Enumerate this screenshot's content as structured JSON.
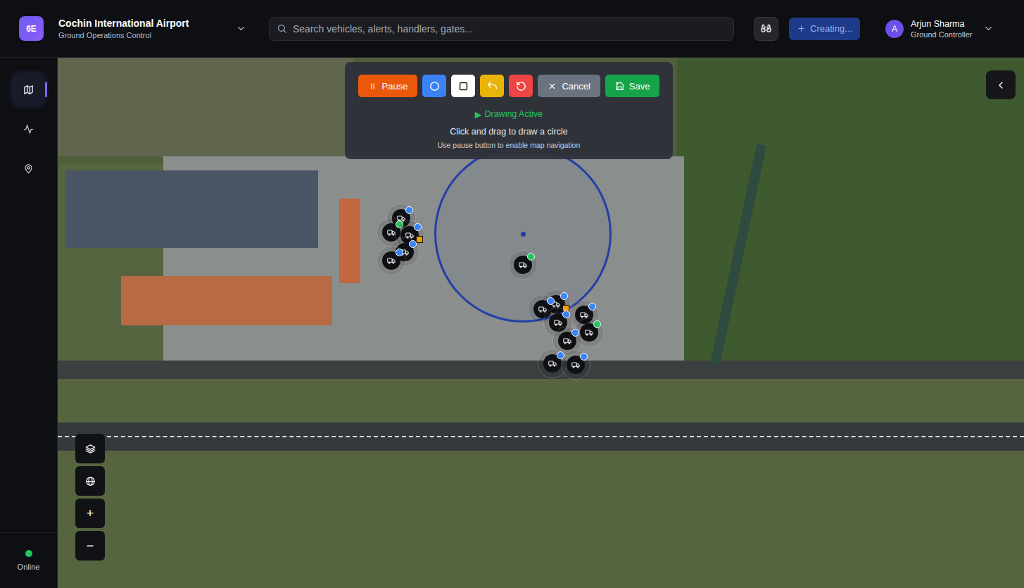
{
  "header": {
    "logo": "6E",
    "title": "Cochin International Airport",
    "subtitle": "Ground Operations Control",
    "search": {
      "placeholder": "Search vehicles, alerts, handlers, gates..."
    },
    "create_button": {
      "label": "Creating...",
      "disabled": true
    },
    "user": {
      "initial": "A",
      "name": "Arjun Sharma",
      "role": "Ground Controller"
    }
  },
  "sidebar": {
    "items": [
      {
        "selected": true
      },
      {
        "selected": false
      },
      {
        "selected": false
      }
    ],
    "status": {
      "label": "Online",
      "color": "#22c55e"
    }
  },
  "drawing_toolbar": {
    "pause": {
      "label": "Pause"
    },
    "shape_tools": [
      {
        "kind": "circle",
        "selected": true
      },
      {
        "kind": "rectangle",
        "selected": false
      }
    ],
    "cancel": {
      "label": "Cancel"
    },
    "save": {
      "label": "Save"
    },
    "status": {
      "icon": "▶",
      "label": "Drawing Active"
    },
    "instruction": "Click and drag to draw a circle",
    "hint": "Use pause button to enable map navigation"
  },
  "map_controls": {
    "zoom_in": "+",
    "zoom_out": "−"
  },
  "markers": [
    {
      "status_color": "#3b82f6",
      "alert": false
    },
    {
      "status_color": "#22c55e",
      "alert": false
    },
    {
      "status_color": "#3b82f6",
      "alert": true
    },
    {
      "status_color": "#3b82f6",
      "alert": false
    },
    {
      "status_color": "#3b82f6",
      "alert": false
    },
    {
      "status_color": "#22c55e",
      "alert": false
    },
    {
      "status_color": "#3b82f6",
      "alert": true
    },
    {
      "status_color": "#3b82f6",
      "alert": false
    },
    {
      "status_color": "#3b82f6",
      "alert": false
    },
    {
      "status_color": "#3b82f6",
      "alert": false
    },
    {
      "status_color": "#22c55e",
      "alert": false
    },
    {
      "status_color": "#3b82f6",
      "alert": false
    },
    {
      "status_color": "#3b82f6",
      "alert": false
    },
    {
      "status_color": "#3b82f6",
      "alert": false
    }
  ]
}
